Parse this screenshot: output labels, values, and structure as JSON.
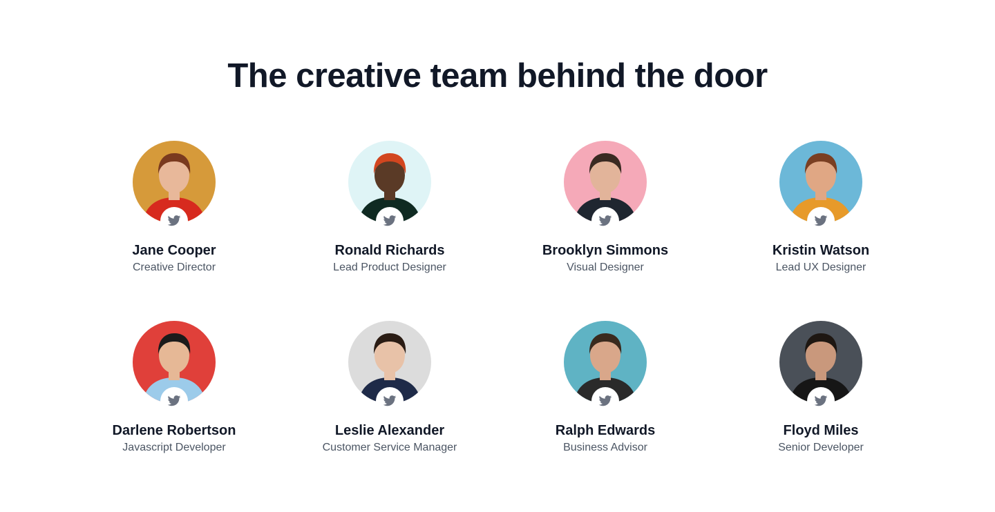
{
  "section": {
    "title": "The creative team behind the door"
  },
  "team": [
    {
      "name": "Jane Cooper",
      "role": "Creative Director",
      "bg": "#d69a3a",
      "hair": "#7a3a1f",
      "skin": "#e8b89a",
      "shirt": "#d72a1e"
    },
    {
      "name": "Ronald Richards",
      "role": "Lead Product Designer",
      "bg": "#dff4f6",
      "hair": "#d2461f",
      "skin": "#5a3a26",
      "shirt": "#0f2a22"
    },
    {
      "name": "Brooklyn Simmons",
      "role": "Visual Designer",
      "bg": "#f5a9b8",
      "hair": "#3a2a22",
      "skin": "#e2b49a",
      "shirt": "#1f2630"
    },
    {
      "name": "Kristin Watson",
      "role": "Lead UX Designer",
      "bg": "#6cb8d8",
      "hair": "#7a3f22",
      "skin": "#e0a784",
      "shirt": "#e79a2a"
    },
    {
      "name": "Darlene Robertson",
      "role": "Javascript Developer",
      "bg": "#e0403a",
      "hair": "#1b1b1b",
      "skin": "#e6b896",
      "shirt": "#9ccbea"
    },
    {
      "name": "Leslie Alexander",
      "role": "Customer Service Manager",
      "bg": "#dcdcdc",
      "hair": "#2a1c14",
      "skin": "#e8c2a8",
      "shirt": "#1e2a48"
    },
    {
      "name": "Ralph Edwards",
      "role": "Business Advisor",
      "bg": "#5fb3c4",
      "hair": "#3a2a1e",
      "skin": "#d9a78a",
      "shirt": "#2a2a2a"
    },
    {
      "name": "Floyd Miles",
      "role": "Senior Developer",
      "bg": "#4a5058",
      "hair": "#1e1712",
      "skin": "#c9987c",
      "shirt": "#161616"
    }
  ],
  "icons": {
    "social": "twitter-icon",
    "social_color": "#6b7280"
  }
}
